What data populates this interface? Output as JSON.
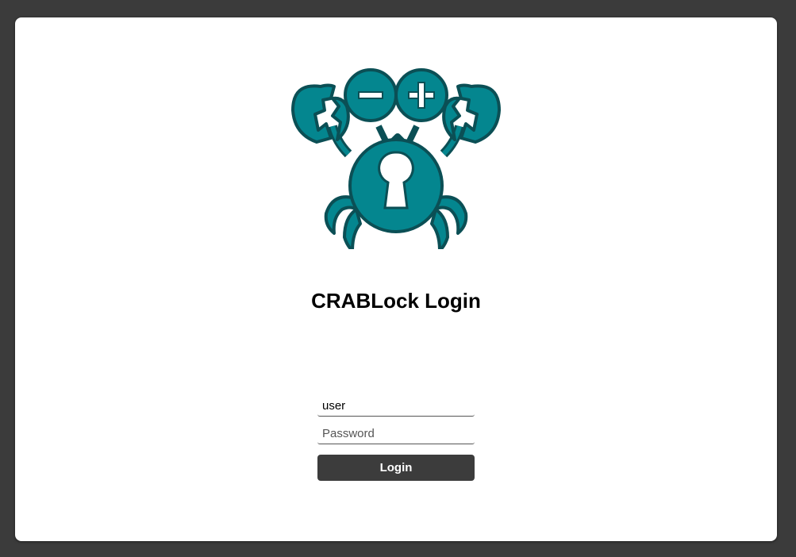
{
  "login": {
    "title": "CRABLock Login",
    "username_value": "user",
    "password_placeholder": "Password",
    "login_button_label": "Login"
  },
  "logo": {
    "icon": "crab-lock-logo",
    "fill_color": "#04868f",
    "stroke_color": "#0b4f55"
  },
  "colors": {
    "background": "#3b3b3b",
    "card": "#ffffff",
    "button": "#3c3c3c"
  }
}
